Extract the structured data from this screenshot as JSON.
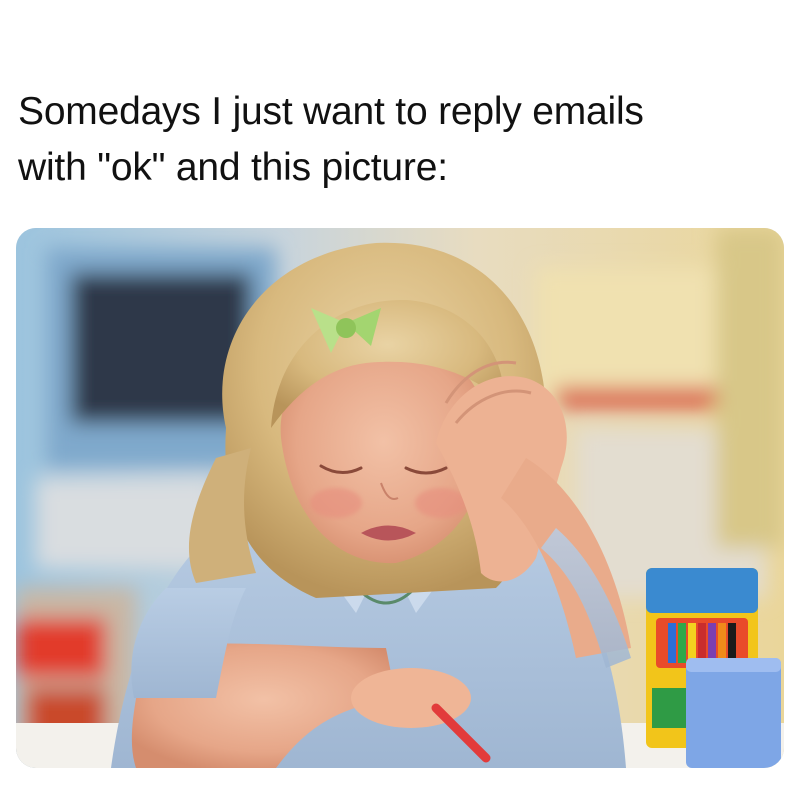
{
  "meme": {
    "caption": "Somedays I just want to reply emails\nwith \"ok\" and this picture:"
  },
  "photo": {
    "subject": "crying-girl-with-crayons"
  }
}
